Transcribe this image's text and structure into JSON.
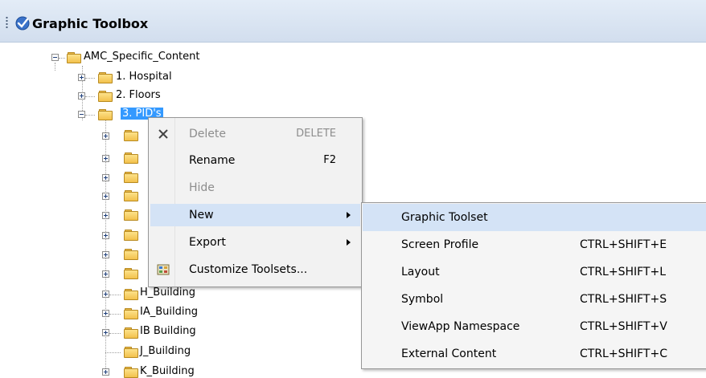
{
  "header": {
    "title": "Graphic Toolbox",
    "icon": "toolbox-check-icon"
  },
  "tree": {
    "root": "AMC_Specific_Content",
    "items": [
      {
        "label": "1. Hospital"
      },
      {
        "label": "2. Floors"
      },
      {
        "label": "3. PID's"
      },
      {
        "label": "H_Building"
      },
      {
        "label": "IA_Building"
      },
      {
        "label": "IB Building"
      },
      {
        "label": "J_Building"
      },
      {
        "label": "K_Building"
      }
    ]
  },
  "context_menu": {
    "items": [
      {
        "label": "Delete",
        "shortcut": "DELETE",
        "disabled": true,
        "icon": "close-x-icon"
      },
      {
        "label": "Rename",
        "shortcut": "F2"
      },
      {
        "label": "Hide",
        "disabled": true
      },
      {
        "label": "New",
        "submenu": true,
        "highlighted": true
      },
      {
        "label": "Export",
        "submenu": true
      },
      {
        "label": "Customize Toolsets...",
        "icon": "customize-toolsets-icon"
      }
    ]
  },
  "submenu": {
    "items": [
      {
        "label": "Graphic Toolset",
        "shortcut": "",
        "highlighted": true
      },
      {
        "label": "Screen Profile",
        "shortcut": "CTRL+SHIFT+E"
      },
      {
        "label": "Layout",
        "shortcut": "CTRL+SHIFT+L"
      },
      {
        "label": "Symbol",
        "shortcut": "CTRL+SHIFT+S"
      },
      {
        "label": "ViewApp Namespace",
        "shortcut": "CTRL+SHIFT+V"
      },
      {
        "label": "External Content",
        "shortcut": "CTRL+SHIFT+C"
      }
    ]
  },
  "colors": {
    "header_bg": "#d9e4f2",
    "selection": "#3399ff",
    "menu_highlight": "#d4e3f6"
  }
}
